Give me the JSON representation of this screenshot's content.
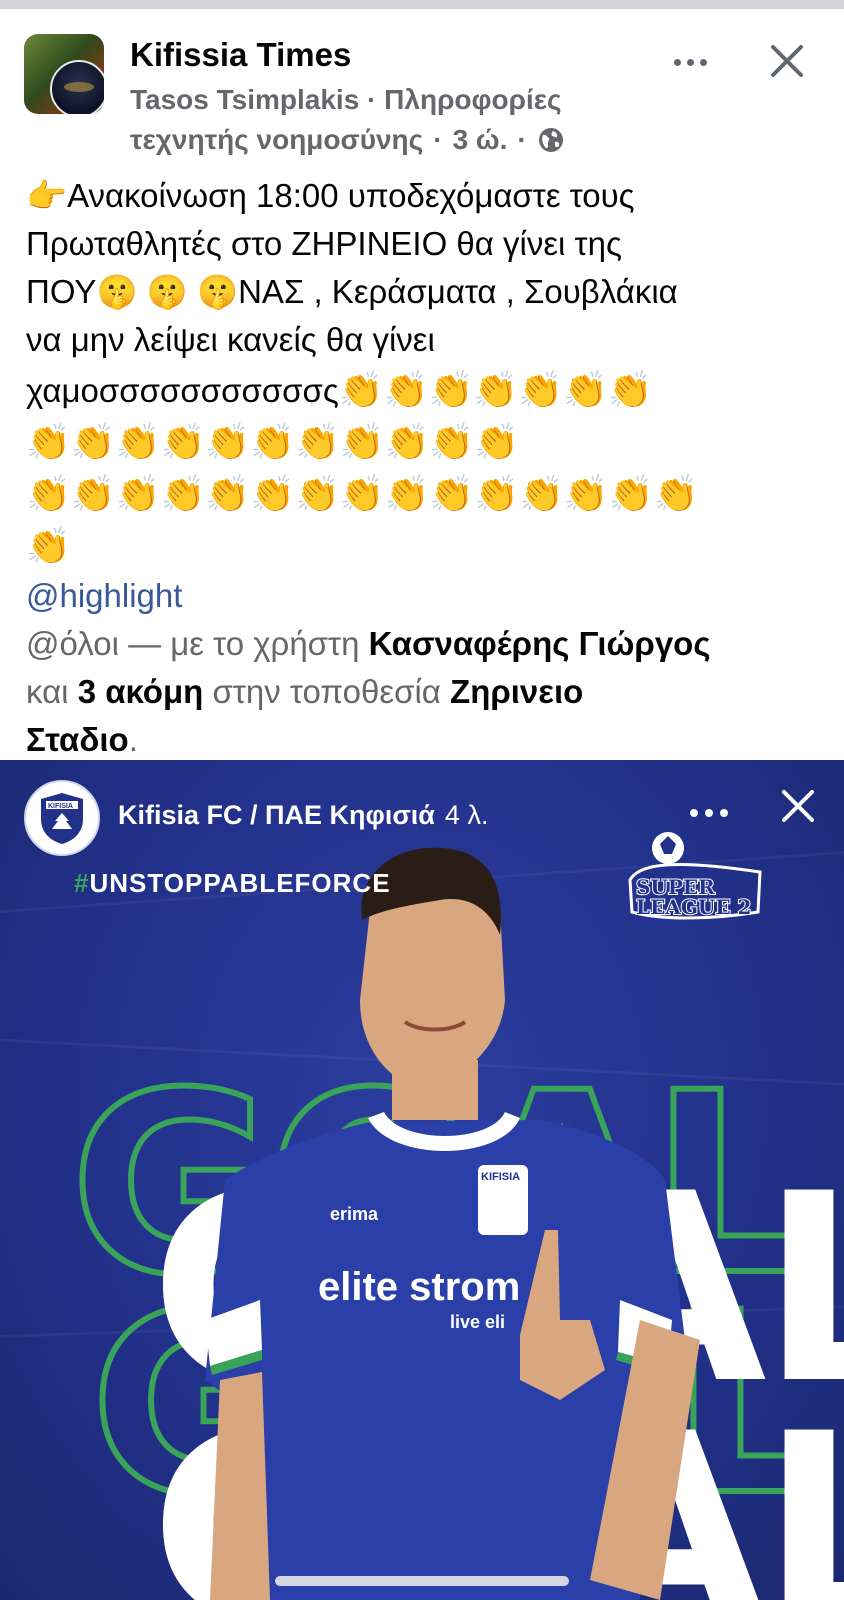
{
  "post": {
    "page_name": "Kifissia Times",
    "author": "Tasos Tsimplakis",
    "separator": " · ",
    "category_line1": "Πληροφορίες",
    "category_line2": "τεχνητής νοημοσύνης",
    "time": "3 ώ.",
    "privacy_icon": "globe-icon"
  },
  "body": {
    "line1_emoji": "👉",
    "line1": "Ανακοίνωση 18:00 υποδεχόμαστε τους",
    "line2": "Πρωταθλητές στο ΖΗΡΙΝΕΙΟ θα γίνει της",
    "line3_a": "ΠΟΥ",
    "line3_emoji": "🤫 🤫 🤫",
    "line3_b": "ΝΑΣ , Κεράσματα , Σουβλάκια",
    "line4": "να μην λείψει κανείς θα γίνει",
    "line5": "χαμοσσσσσσσσσσσς",
    "clap_row1": "👏👏👏👏👏👏👏",
    "clap_row2": "👏👏👏👏👏👏👏👏👏👏👏",
    "clap_row3": "👏👏👏👏👏👏👏👏👏👏👏👏👏👏👏",
    "clap_row4": "👏",
    "mention": "@highlight",
    "tag_prefix": "@όλοι — με το χρήστη ",
    "tag_person": "Κασναφέρης Γιώργος",
    "tag_and": "και ",
    "tag_more": "3 ακόμη",
    "tag_place_prefix": " στην τοποθεσία ",
    "tag_place_a": "Ζηρινειο",
    "tag_place_b": "Σταδιο",
    "tag_end": "."
  },
  "shared_story": {
    "account": "Kifisia FC / ΠΑΕ Κηφισιά",
    "age": "4 λ.",
    "hashtag_mark": "#",
    "hashtag": "UNSTOPPABLEFORCE",
    "league_line1": "SUPER",
    "league_line2": "LEAGUE 2",
    "goal_word": "GOAL",
    "jersey_sponsor": "elite strom",
    "jersey_sub": "live eli",
    "jersey_brand": "erima",
    "jersey_crest": "KIFISIA"
  },
  "colors": {
    "meta_gray": "#65676b",
    "mention_blue": "#385898",
    "story_blue": "#22318a",
    "goal_green": "#3aa35a"
  }
}
